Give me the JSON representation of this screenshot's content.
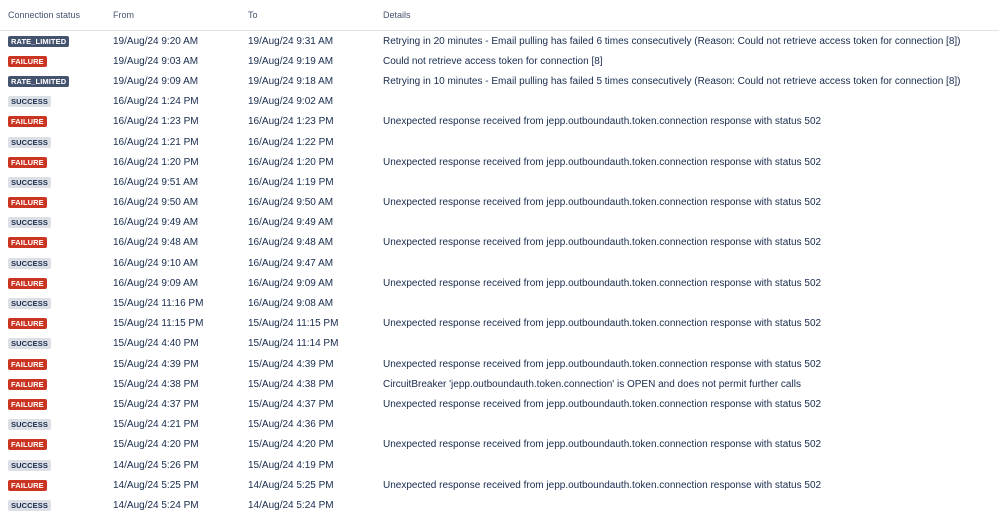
{
  "header": {
    "status": "Connection status",
    "from": "From",
    "to": "To",
    "details": "Details"
  },
  "colors": {
    "rate_limited": "#44546f",
    "failure": "#ca3521",
    "success": "#dcdfe4"
  },
  "rows": [
    {
      "status": "RATE_LIMITED",
      "kind": "rate",
      "from": "19/Aug/24 9:20 AM",
      "to": "19/Aug/24 9:31 AM",
      "details": "Retrying in 20 minutes - Email pulling has failed 6 times consecutively (Reason: Could not retrieve access token for connection [8])"
    },
    {
      "status": "FAILURE",
      "kind": "fail",
      "from": "19/Aug/24 9:03 AM",
      "to": "19/Aug/24 9:19 AM",
      "details": "Could not retrieve access token for connection [8]"
    },
    {
      "status": "RATE_LIMITED",
      "kind": "rate",
      "from": "19/Aug/24 9:09 AM",
      "to": "19/Aug/24 9:18 AM",
      "details": "Retrying in 10 minutes - Email pulling has failed 5 times consecutively (Reason: Could not retrieve access token for connection [8])"
    },
    {
      "status": "SUCCESS",
      "kind": "ok",
      "from": "16/Aug/24 1:24 PM",
      "to": "19/Aug/24 9:02 AM",
      "details": ""
    },
    {
      "status": "FAILURE",
      "kind": "fail",
      "from": "16/Aug/24 1:23 PM",
      "to": "16/Aug/24 1:23 PM",
      "details": "Unexpected response received from jepp.outboundauth.token.connection response with status 502"
    },
    {
      "status": "SUCCESS",
      "kind": "ok",
      "from": "16/Aug/24 1:21 PM",
      "to": "16/Aug/24 1:22 PM",
      "details": ""
    },
    {
      "status": "FAILURE",
      "kind": "fail",
      "from": "16/Aug/24 1:20 PM",
      "to": "16/Aug/24 1:20 PM",
      "details": "Unexpected response received from jepp.outboundauth.token.connection response with status 502"
    },
    {
      "status": "SUCCESS",
      "kind": "ok",
      "from": "16/Aug/24 9:51 AM",
      "to": "16/Aug/24 1:19 PM",
      "details": ""
    },
    {
      "status": "FAILURE",
      "kind": "fail",
      "from": "16/Aug/24 9:50 AM",
      "to": "16/Aug/24 9:50 AM",
      "details": "Unexpected response received from jepp.outboundauth.token.connection response with status 502"
    },
    {
      "status": "SUCCESS",
      "kind": "ok",
      "from": "16/Aug/24 9:49 AM",
      "to": "16/Aug/24 9:49 AM",
      "details": ""
    },
    {
      "status": "FAILURE",
      "kind": "fail",
      "from": "16/Aug/24 9:48 AM",
      "to": "16/Aug/24 9:48 AM",
      "details": "Unexpected response received from jepp.outboundauth.token.connection response with status 502"
    },
    {
      "status": "SUCCESS",
      "kind": "ok",
      "from": "16/Aug/24 9:10 AM",
      "to": "16/Aug/24 9:47 AM",
      "details": ""
    },
    {
      "status": "FAILURE",
      "kind": "fail",
      "from": "16/Aug/24 9:09 AM",
      "to": "16/Aug/24 9:09 AM",
      "details": "Unexpected response received from jepp.outboundauth.token.connection response with status 502"
    },
    {
      "status": "SUCCESS",
      "kind": "ok",
      "from": "15/Aug/24 11:16 PM",
      "to": "16/Aug/24 9:08 AM",
      "details": ""
    },
    {
      "status": "FAILURE",
      "kind": "fail",
      "from": "15/Aug/24 11:15 PM",
      "to": "15/Aug/24 11:15 PM",
      "details": "Unexpected response received from jepp.outboundauth.token.connection response with status 502"
    },
    {
      "status": "SUCCESS",
      "kind": "ok",
      "from": "15/Aug/24 4:40 PM",
      "to": "15/Aug/24 11:14 PM",
      "details": ""
    },
    {
      "status": "FAILURE",
      "kind": "fail",
      "from": "15/Aug/24 4:39 PM",
      "to": "15/Aug/24 4:39 PM",
      "details": "Unexpected response received from jepp.outboundauth.token.connection response with status 502"
    },
    {
      "status": "FAILURE",
      "kind": "fail",
      "from": "15/Aug/24 4:38 PM",
      "to": "15/Aug/24 4:38 PM",
      "details": "CircuitBreaker 'jepp.outboundauth.token.connection' is OPEN and does not permit further calls"
    },
    {
      "status": "FAILURE",
      "kind": "fail",
      "from": "15/Aug/24 4:37 PM",
      "to": "15/Aug/24 4:37 PM",
      "details": "Unexpected response received from jepp.outboundauth.token.connection response with status 502"
    },
    {
      "status": "SUCCESS",
      "kind": "ok",
      "from": "15/Aug/24 4:21 PM",
      "to": "15/Aug/24 4:36 PM",
      "details": ""
    },
    {
      "status": "FAILURE",
      "kind": "fail",
      "from": "15/Aug/24 4:20 PM",
      "to": "15/Aug/24 4:20 PM",
      "details": "Unexpected response received from jepp.outboundauth.token.connection response with status 502"
    },
    {
      "status": "SUCCESS",
      "kind": "ok",
      "from": "14/Aug/24 5:26 PM",
      "to": "15/Aug/24 4:19 PM",
      "details": ""
    },
    {
      "status": "FAILURE",
      "kind": "fail",
      "from": "14/Aug/24 5:25 PM",
      "to": "14/Aug/24 5:25 PM",
      "details": "Unexpected response received from jepp.outboundauth.token.connection response with status 502"
    },
    {
      "status": "SUCCESS",
      "kind": "ok",
      "from": "14/Aug/24 5:24 PM",
      "to": "14/Aug/24 5:24 PM",
      "details": ""
    }
  ]
}
